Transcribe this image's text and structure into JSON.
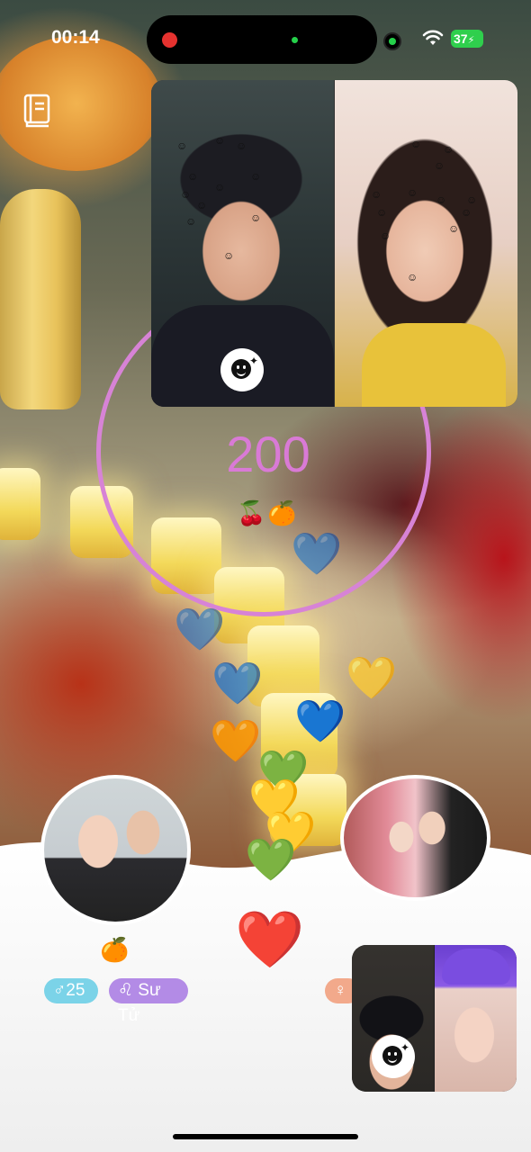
{
  "status_bar": {
    "time": "00:14",
    "battery": "37",
    "icons": [
      "recording-dot-icon",
      "mic-indicator-icon",
      "camera-indicator-icon",
      "wifi-icon",
      "battery-icon"
    ]
  },
  "toolbar": {
    "guide_icon": "book-icon"
  },
  "score": {
    "value": "200",
    "fruits": "🍒🍊"
  },
  "floating_hearts": [
    "💙",
    "💙",
    "💙",
    "💛",
    "🧡",
    "🧡",
    "💚",
    "💛",
    "💛",
    "💚",
    "💙"
  ],
  "center_heart": "❤️",
  "left_profile": {
    "fruit": "🍊",
    "age_badge": "♂25",
    "zodiac_badge": "♌ Sư Tử"
  },
  "right_profile": {
    "gender_badge": "♀"
  },
  "colors": {
    "ring": "#d783d6",
    "score_text": "#d97ad6",
    "age_badge_bg": "#7bd3e8",
    "zodiac_badge_bg": "#b38be6",
    "peach_badge_bg": "#f2a98b"
  }
}
